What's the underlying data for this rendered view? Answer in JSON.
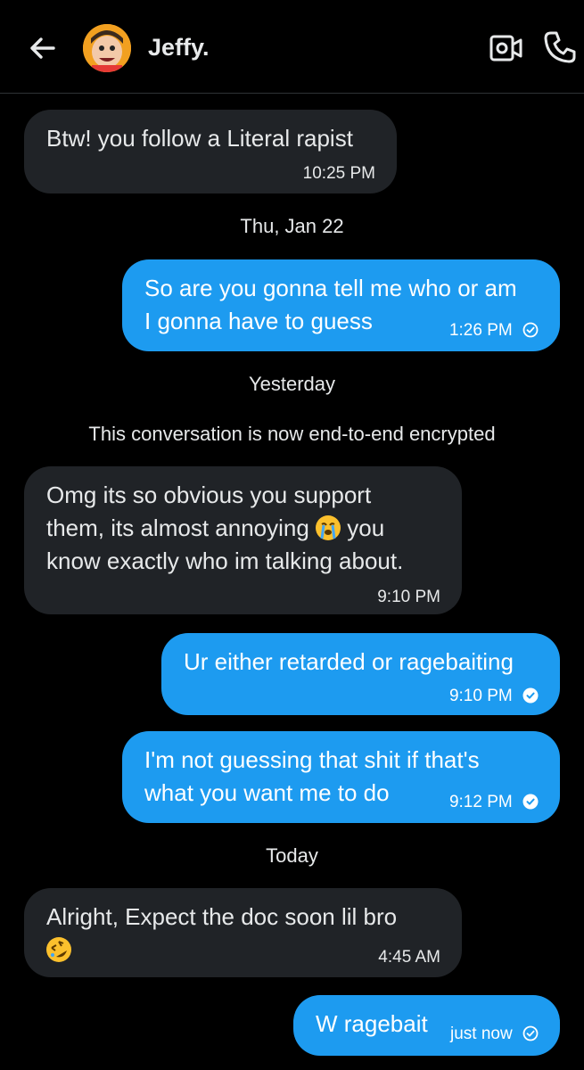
{
  "header": {
    "contact_name": "Jeffy."
  },
  "icons": {
    "back": "arrow-left-icon",
    "video": "video-call-icon",
    "phone": "phone-icon",
    "sent_status": "check-circle-icon",
    "seen_status": "check-circle-filled-icon"
  },
  "colors": {
    "background": "#000000",
    "received_bubble": "#202327",
    "sent_bubble": "#1d9bf0"
  },
  "messages": [
    {
      "text": "Btw! you follow a Literal rapist",
      "time": "10:25 PM",
      "direction": "received"
    },
    {
      "divider": "Thu, Jan 22"
    },
    {
      "text": "So are you gonna tell me who or am\nI gonna have to guess",
      "time": "1:26 PM",
      "direction": "sent",
      "status": "sent"
    },
    {
      "divider": "Yesterday"
    },
    {
      "notice": "This conversation is now end-to-end encrypted"
    },
    {
      "text_before_emoji": "Omg its so obvious you support\nthem, its almost annoying",
      "emoji": "loudly-crying-face",
      "text_after_emoji": "you\nknow exactly who im talking about.",
      "time": "9:10 PM",
      "direction": "received"
    },
    {
      "text": "Ur either retarded or ragebaiting",
      "time": "9:10 PM",
      "direction": "sent",
      "status": "seen"
    },
    {
      "text": "I'm not guessing that shit if that's\nwhat you want me to do",
      "time": "9:12 PM",
      "direction": "sent",
      "status": "seen"
    },
    {
      "divider": "Today"
    },
    {
      "text": "Alright, Expect the doc soon lil bro",
      "emoji": "rolling-on-floor-laughing",
      "time": "4:45 AM",
      "direction": "received"
    },
    {
      "text": "W ragebait",
      "time": "just now",
      "direction": "sent",
      "status": "sent"
    }
  ]
}
